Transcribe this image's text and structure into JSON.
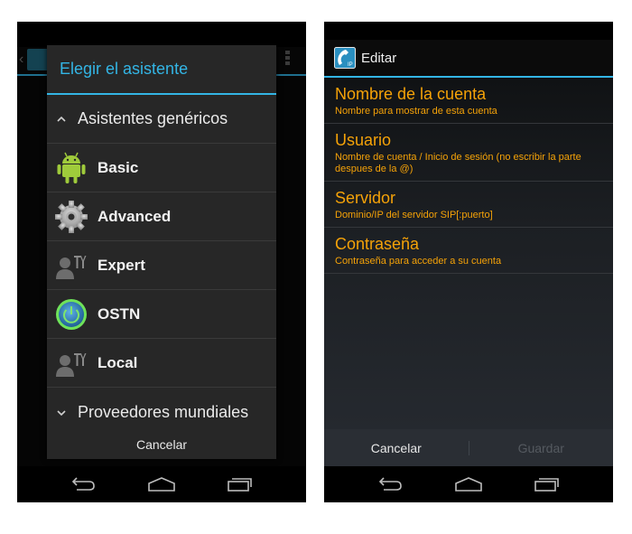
{
  "left_screen": {
    "dialog": {
      "title": "Elegir el asistente",
      "groups": [
        {
          "label": "Asistentes genéricos",
          "expanded": true,
          "icon": "chevron-up-icon"
        },
        {
          "label": "Proveedores mundiales",
          "expanded": false,
          "icon": "chevron-down-icon"
        }
      ],
      "wizards": [
        {
          "label": "Basic",
          "icon": "android-robot-icon"
        },
        {
          "label": "Advanced",
          "icon": "gear-icon"
        },
        {
          "label": "Expert",
          "icon": "user-tools-icon"
        },
        {
          "label": "OSTN",
          "icon": "ostn-power-globe-icon"
        },
        {
          "label": "Local",
          "icon": "user-tools-icon"
        }
      ],
      "cancel_label": "Cancelar"
    },
    "background": {
      "back_glyph": "‹"
    }
  },
  "right_screen": {
    "actionbar": {
      "title": "Editar",
      "icon": "sip-phone-ip-icon"
    },
    "preferences": [
      {
        "title": "Nombre de la cuenta",
        "summary": "Nombre para mostrar de esta cuenta"
      },
      {
        "title": "Usuario",
        "summary": "Nombre de cuenta / Inicio de sesión (no escribir la parte despues de la @)"
      },
      {
        "title": "Servidor",
        "summary": "Dominio/IP del servidor SIP[:puerto]"
      },
      {
        "title": "Contraseña",
        "summary": "Contraseña para acceder a su cuenta"
      }
    ],
    "buttons": {
      "cancel_label": "Cancelar",
      "save_label": "Guardar",
      "save_enabled": false
    }
  },
  "navbar": {
    "buttons": [
      {
        "name": "back",
        "icon": "back-icon"
      },
      {
        "name": "home",
        "icon": "home-icon"
      },
      {
        "name": "recents",
        "icon": "recents-icon"
      }
    ]
  },
  "colors": {
    "accent_blue": "#33b5e5",
    "pref_orange": "#f5a208",
    "dialog_bg": "#272727"
  }
}
